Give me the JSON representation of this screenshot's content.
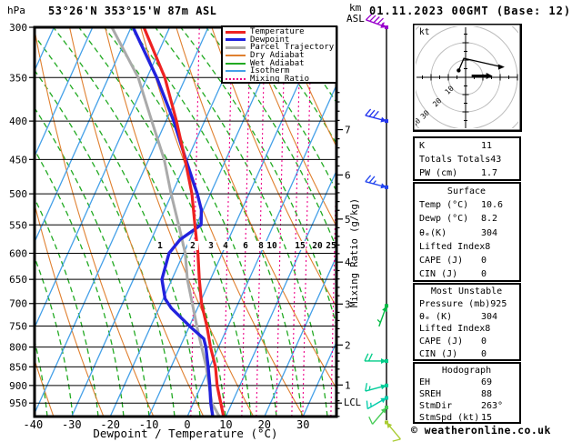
{
  "header": {
    "station": "53°26'N 353°15'W 87m ASL",
    "datetime": "01.11.2023 00GMT (Base: 12)",
    "pressure_unit": "hPa",
    "alt_unit_line1": "km",
    "alt_unit_line2": "ASL",
    "copyright": "© weatheronline.co.uk"
  },
  "legend": [
    {
      "label": "Temperature",
      "color": "#ee2222",
      "style": "solid"
    },
    {
      "label": "Dewpoint",
      "color": "#2222dd",
      "style": "solid"
    },
    {
      "label": "Parcel Trajectory",
      "color": "#aaaaaa",
      "style": "solid"
    },
    {
      "label": "Dry Adiabat",
      "color": "#e08030",
      "style": "thin"
    },
    {
      "label": "Wet Adiabat",
      "color": "#22aa22",
      "style": "thin"
    },
    {
      "label": "Isotherm",
      "color": "#44a0e8",
      "style": "thin"
    },
    {
      "label": "Mixing Ratio",
      "color": "#ee0088",
      "style": "dotted"
    }
  ],
  "axes": {
    "pressure_ticks": [
      300,
      350,
      400,
      450,
      500,
      550,
      600,
      650,
      700,
      750,
      800,
      850,
      900,
      950
    ],
    "temp_ticks": [
      -40,
      -30,
      -20,
      -10,
      0,
      10,
      20,
      30
    ],
    "x_title": "Dewpoint / Temperature (°C)",
    "km_ticks": [
      1,
      2,
      3,
      4,
      5,
      6,
      7
    ],
    "lcl_label": "LCL",
    "mixing_ratio_axis_label": "Mixing Ratio (g/kg)",
    "mixing_ratio_values": [
      1,
      2,
      3,
      4,
      6,
      8,
      10,
      15,
      20,
      25
    ]
  },
  "chart_data": {
    "type": "line",
    "subtype": "skewt-logp",
    "pressure_range_hpa": [
      300,
      990
    ],
    "temp_axis_range_c": [
      -40,
      38
    ],
    "series": [
      {
        "name": "Temperature",
        "color": "#ee2222",
        "points_p_t": [
          [
            990,
            9.4
          ],
          [
            950,
            7.1
          ],
          [
            900,
            4.1
          ],
          [
            850,
            1.5
          ],
          [
            800,
            -2.1
          ],
          [
            750,
            -5.5
          ],
          [
            700,
            -9.5
          ],
          [
            650,
            -12.9
          ],
          [
            600,
            -16.3
          ],
          [
            550,
            -20.4
          ],
          [
            500,
            -24.8
          ],
          [
            450,
            -30.6
          ],
          [
            400,
            -37.3
          ],
          [
            350,
            -45.4
          ],
          [
            300,
            -56.7
          ]
        ]
      },
      {
        "name": "Dewpoint",
        "color": "#2222dd",
        "points_p_t": [
          [
            990,
            6.6
          ],
          [
            950,
            4.5
          ],
          [
            900,
            2.2
          ],
          [
            850,
            -0.4
          ],
          [
            800,
            -3.3
          ],
          [
            780,
            -4.8
          ],
          [
            750,
            -10
          ],
          [
            710,
            -16.8
          ],
          [
            690,
            -19.5
          ],
          [
            650,
            -22.6
          ],
          [
            600,
            -23.8
          ],
          [
            575,
            -22.5
          ],
          [
            550,
            -18.8
          ],
          [
            525,
            -20.5
          ],
          [
            500,
            -23.4
          ],
          [
            450,
            -30.4
          ],
          [
            400,
            -38
          ],
          [
            350,
            -47.5
          ],
          [
            300,
            -59.5
          ]
        ]
      },
      {
        "name": "Parcel Trajectory",
        "color": "#aaaaaa",
        "points_p_t": [
          [
            990,
            8.3
          ],
          [
            950,
            4.8
          ],
          [
            900,
            2.0
          ],
          [
            850,
            -0.9
          ],
          [
            800,
            -4.4
          ],
          [
            750,
            -8.1
          ],
          [
            700,
            -11.9
          ],
          [
            650,
            -16.0
          ],
          [
            600,
            -19.6
          ],
          [
            550,
            -24.6
          ],
          [
            500,
            -30.2
          ],
          [
            450,
            -36.0
          ],
          [
            400,
            -43.7
          ],
          [
            350,
            -52.3
          ],
          [
            300,
            -65.0
          ]
        ]
      }
    ],
    "wind_barbs": [
      {
        "pressure": 300,
        "speed_kt": 45,
        "dir_deg": 290,
        "color": "#9900cc"
      },
      {
        "pressure": 400,
        "speed_kt": 30,
        "dir_deg": 285,
        "color": "#2233ee"
      },
      {
        "pressure": 490,
        "speed_kt": 25,
        "dir_deg": 285,
        "color": "#2244ee"
      },
      {
        "pressure": 705,
        "speed_kt": 5,
        "dir_deg": 200,
        "color": "#00bb44"
      },
      {
        "pressure": 835,
        "speed_kt": 20,
        "dir_deg": 270,
        "color": "#00cc88"
      },
      {
        "pressure": 900,
        "speed_kt": 15,
        "dir_deg": 255,
        "color": "#00cc99"
      },
      {
        "pressure": 935,
        "speed_kt": 15,
        "dir_deg": 240,
        "color": "#00ccaa"
      },
      {
        "pressure": 963,
        "speed_kt": 10,
        "dir_deg": 220,
        "color": "#44cc55"
      },
      {
        "pressure": 1008,
        "speed_kt": 10,
        "dir_deg": 140,
        "color": "#aacc33"
      }
    ],
    "hodograph": {
      "unit": "kt",
      "rings_kt": [
        10,
        20,
        30,
        40
      ],
      "trace_uv_kt": [
        [
          -4,
          4
        ],
        [
          -1,
          11
        ],
        [
          21,
          6
        ]
      ],
      "storm_vector_uv_kt": [
        [
          3.5,
          0.8
        ],
        [
          13,
          0.8
        ]
      ]
    }
  },
  "panels": {
    "indices": {
      "rows": [
        [
          "K",
          "11"
        ],
        [
          "Totals Totals",
          "43"
        ],
        [
          "PW (cm)",
          "1.7"
        ]
      ]
    },
    "surface": {
      "title": "Surface",
      "rows": [
        [
          "Temp (°C)",
          "10.6"
        ],
        [
          "Dewp (°C)",
          "8.2"
        ],
        [
          "θₑ(K)",
          "304"
        ],
        [
          "Lifted Index",
          "8"
        ],
        [
          "CAPE (J)",
          "0"
        ],
        [
          "CIN (J)",
          "0"
        ]
      ]
    },
    "most_unstable": {
      "title": "Most Unstable",
      "rows": [
        [
          "Pressure (mb)",
          "925"
        ],
        [
          "θₑ (K)",
          "304"
        ],
        [
          "Lifted Index",
          "8"
        ],
        [
          "CAPE (J)",
          "0"
        ],
        [
          "CIN (J)",
          "0"
        ]
      ]
    },
    "hodograph_panel": {
      "title": "Hodograph",
      "rows": [
        [
          "EH",
          "69"
        ],
        [
          "SREH",
          "88"
        ],
        [
          "StmDir",
          "263°"
        ],
        [
          "StmSpd (kt)",
          "15"
        ]
      ]
    }
  }
}
